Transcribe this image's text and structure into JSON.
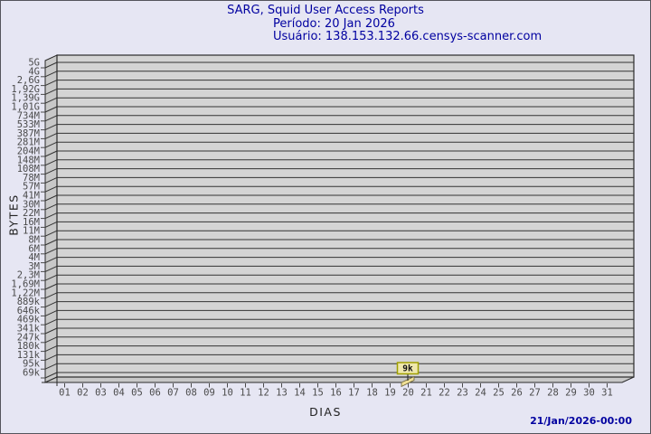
{
  "header": {
    "title": "SARG, Squid User Access Reports",
    "period": "Período: 20 Jan 2026",
    "user": "Usuário: 138.153.132.66.censys-scanner.com"
  },
  "footer": {
    "generated": "21/Jan/2026-00:00"
  },
  "chart_data": {
    "type": "bar",
    "title": "SARG, Squid User Access Reports",
    "xlabel": "DIAS",
    "ylabel": "BYTES",
    "x_categories": [
      "01",
      "02",
      "03",
      "04",
      "05",
      "06",
      "07",
      "08",
      "09",
      "10",
      "11",
      "12",
      "13",
      "14",
      "15",
      "16",
      "17",
      "18",
      "19",
      "20",
      "21",
      "22",
      "23",
      "24",
      "25",
      "26",
      "27",
      "28",
      "29",
      "30",
      "31"
    ],
    "y_tick_labels": [
      "5G",
      "4G",
      "2,6G",
      "1,92G",
      "1,39G",
      "1,01G",
      "734M",
      "533M",
      "387M",
      "281M",
      "204M",
      "148M",
      "108M",
      "78M",
      "57M",
      "41M",
      "30M",
      "22M",
      "16M",
      "11M",
      "8M",
      "6M",
      "4M",
      "3M",
      "2,3M",
      "1,69M",
      "1,22M",
      "889k",
      "646k",
      "469k",
      "341k",
      "247k",
      "180k",
      "131k",
      "95k",
      "69k"
    ],
    "bars": [
      {
        "day": "20",
        "value_label": "9k"
      }
    ],
    "grid": true,
    "legend_position": "none",
    "colors": {
      "background": "#e6e6f3",
      "plot_fill": "#d4d4d4",
      "wall_fill": "#c8c8c8",
      "grid_line": "#333333",
      "plot_border": "#2a2a2a",
      "bar_fill": "#f0e096",
      "bar_border": "#6b6136",
      "flag_fill": "#efe8ac",
      "flag_border": "#a0a000",
      "title_text": "#0000a0",
      "tick_text": "#4a4a4a",
      "axis_title_text": "#222222"
    }
  }
}
